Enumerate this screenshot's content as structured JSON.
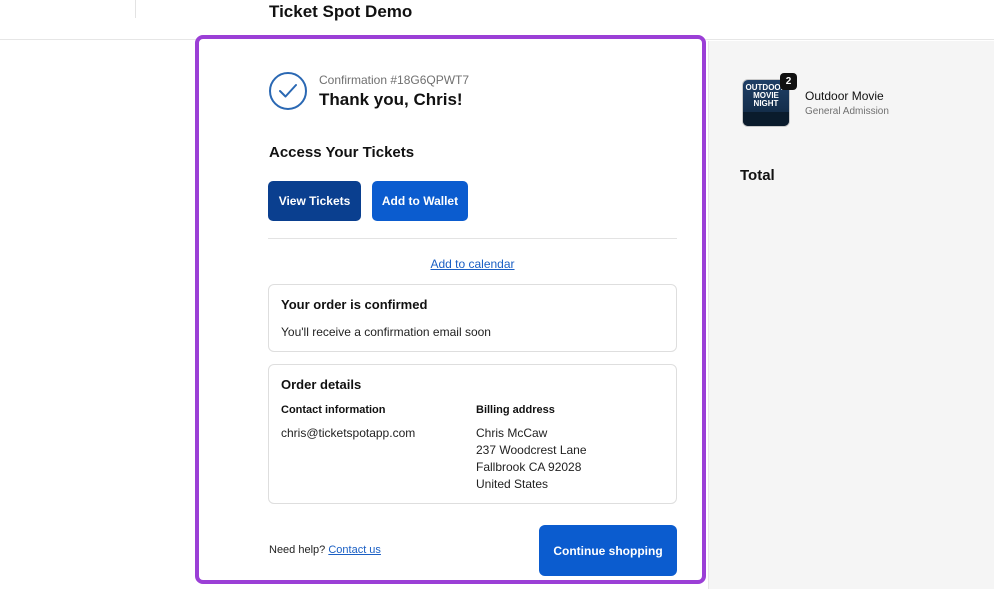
{
  "header": {
    "shop_title": "Ticket Spot Demo"
  },
  "confirmation": {
    "number_text": "Confirmation #18G6QPWT7",
    "thanks_text": "Thank you, Chris!",
    "check_icon": "checkmark-circle-icon"
  },
  "tickets": {
    "section_title": "Access Your Tickets",
    "view_button": "View Tickets",
    "wallet_button": "Add to Wallet",
    "calendar_link": "Add to calendar"
  },
  "order_status": {
    "title": "Your order is confirmed",
    "message": "You'll receive a confirmation email soon"
  },
  "order_details": {
    "title": "Order details",
    "contact": {
      "heading": "Contact information",
      "email": "chris@ticketspotapp.com"
    },
    "billing": {
      "heading": "Billing address",
      "lines": [
        "Chris McCaw",
        "237 Woodcrest Lane",
        "Fallbrook CA 92028",
        "United States"
      ]
    }
  },
  "footer": {
    "help_prefix": "Need help?",
    "contact_link": "Contact us",
    "continue_button": "Continue shopping"
  },
  "summary": {
    "item": {
      "image_text": [
        "OUTDOOR",
        "MOVIE",
        "NIGHT"
      ],
      "quantity": "2",
      "name": "Outdoor Movie",
      "variant": "General Admission"
    },
    "total_label": "Total"
  },
  "colors": {
    "primary_dark": "#0a3f8f",
    "primary": "#0b5ccf",
    "link": "#1a5fc4",
    "highlight_frame": "#9b3fd6",
    "check_stroke": "#2a68b3"
  }
}
